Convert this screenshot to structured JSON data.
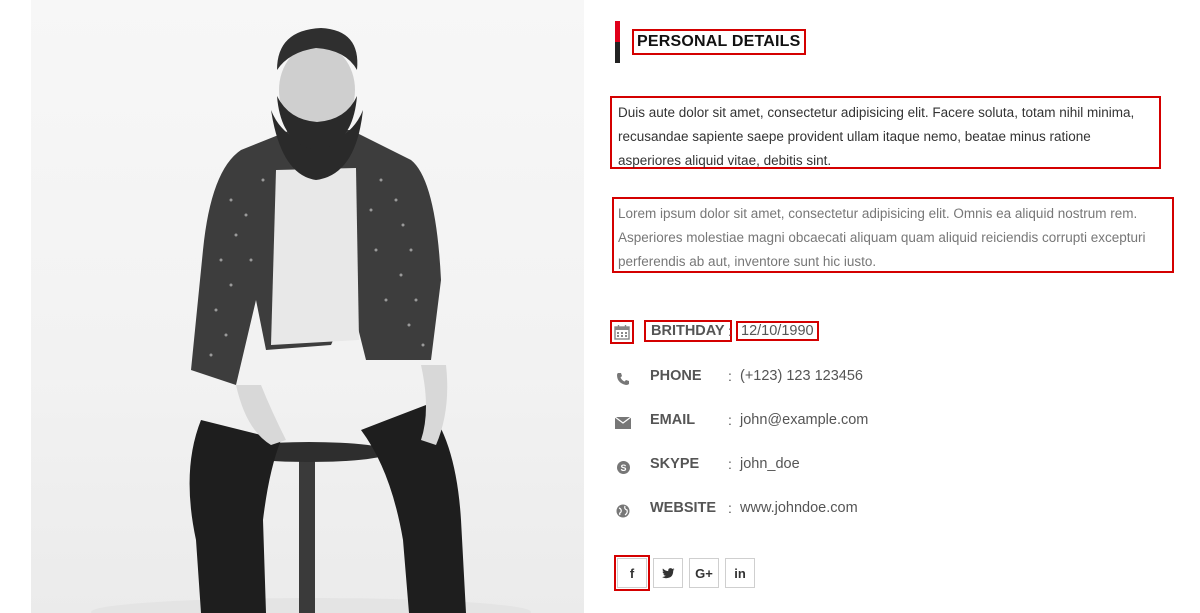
{
  "section": {
    "title": "PERSONAL DETAILS"
  },
  "paragraphs": {
    "p1": "Duis aute dolor sit amet, consectetur adipisicing elit. Facere soluta, totam nihil minima, recusandae sapiente saepe provident ullam itaque nemo, beatae minus ratione asperiores aliquid vitae, debitis sint.",
    "p2": "Lorem ipsum dolor sit amet, consectetur adipisicing elit. Omnis ea aliquid nostrum rem. Asperiores molestiae magni obcaecati aliquam quam aliquid reiciendis corrupti excepturi perferendis ab aut, inventore sunt hic iusto."
  },
  "details": [
    {
      "icon": "calendar-icon",
      "label": "BRITHDAY",
      "value": "12/10/1990"
    },
    {
      "icon": "phone-icon",
      "label": "PHONE",
      "value": "(+123) 123 123456"
    },
    {
      "icon": "envelope-icon",
      "label": "EMAIL",
      "value": "john@example.com"
    },
    {
      "icon": "skype-icon",
      "label": "SKYPE",
      "value": "john_doe"
    },
    {
      "icon": "globe-icon",
      "label": "WEBSITE",
      "value": "www.johndoe.com"
    }
  ],
  "separator": ":",
  "socials": [
    {
      "icon": "facebook-icon",
      "glyph": "f"
    },
    {
      "icon": "twitter-icon",
      "glyph": ""
    },
    {
      "icon": "google-plus-icon",
      "glyph": "G+"
    },
    {
      "icon": "linkedin-icon",
      "glyph": "in"
    }
  ],
  "colors": {
    "accent": "#e0001a",
    "highlight_box": "#d40000",
    "text": "#555555"
  }
}
